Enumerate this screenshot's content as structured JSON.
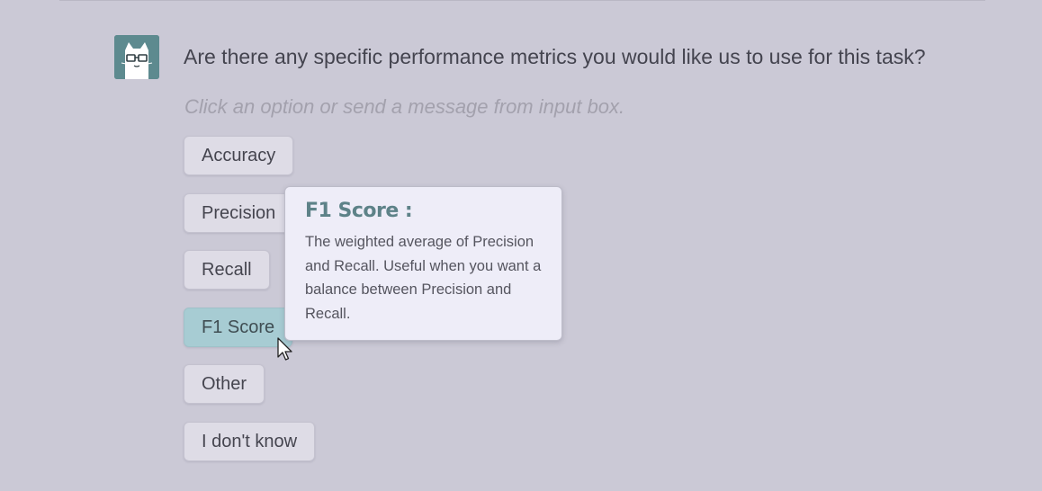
{
  "chat": {
    "question": "Are there any specific performance metrics you would like us to use for this task?",
    "hint": "Click an option or send a message from input box."
  },
  "options": [
    {
      "label": "Accuracy"
    },
    {
      "label": "Precision"
    },
    {
      "label": "Recall"
    },
    {
      "label": "F1 Score",
      "state": "hovered"
    },
    {
      "label": "Other"
    },
    {
      "label": "I don't know"
    }
  ],
  "tooltip": {
    "title": "F1 Score :",
    "body": "The weighted average of Precision and Recall. Useful when you want a balance between Precision and Recall."
  },
  "colors": {
    "background": "#cbc9d6",
    "avatar": "#5d8a8f",
    "option_hover": "#a7ccd3",
    "tooltip_title": "#5d8288"
  },
  "icons": {
    "avatar": "cat-with-glasses-icon",
    "cursor": "mouse-pointer-icon"
  }
}
